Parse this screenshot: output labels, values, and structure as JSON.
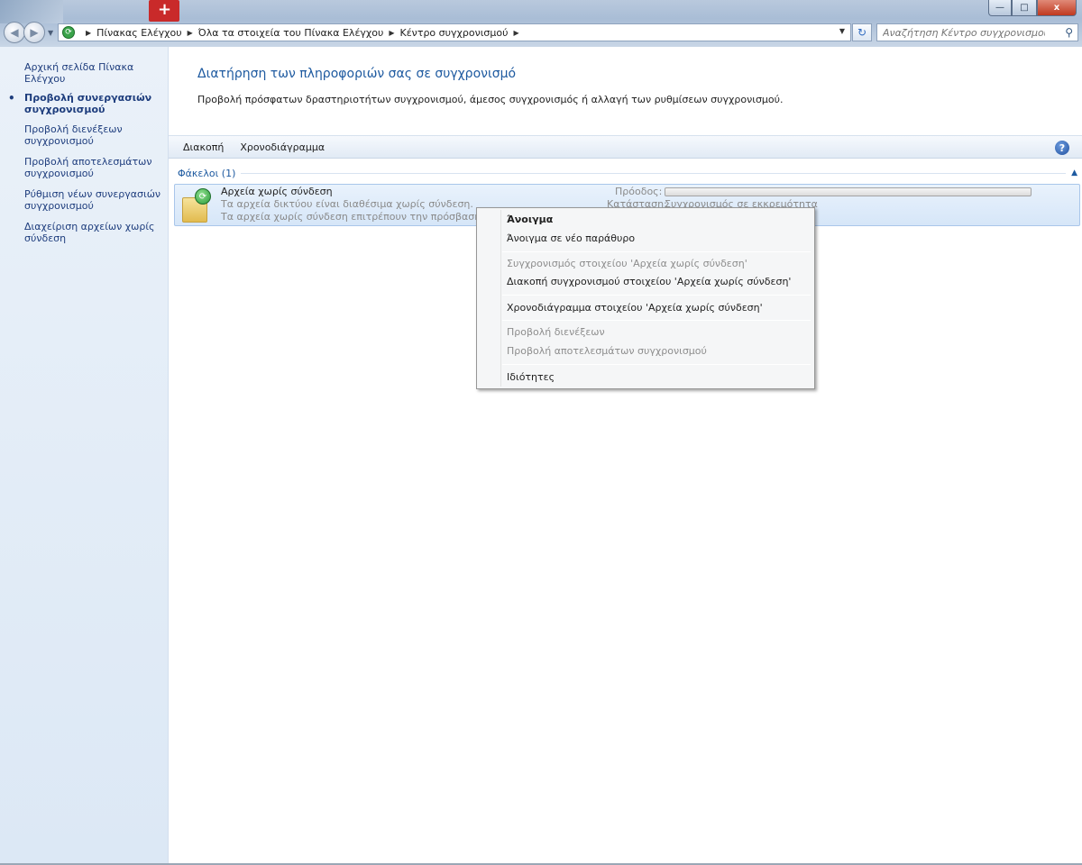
{
  "window": {
    "min_icon": "minimize-icon",
    "max_icon": "maximize-icon",
    "close_icon": "close-icon",
    "close_glyph": "x"
  },
  "address": {
    "segments": [
      "Πίνακας Ελέγχου",
      "Όλα τα στοιχεία του Πίνακα Ελέγχου",
      "Κέντρο συγχρονισμού"
    ]
  },
  "search": {
    "placeholder": "Αναζήτηση Κέντρο συγχρονισμού"
  },
  "sidebar": {
    "items": [
      {
        "label": "Αρχική σελίδα Πίνακα Ελέγχου",
        "active": false
      },
      {
        "label": "Προβολή συνεργασιών συγχρονισμού",
        "active": true
      },
      {
        "label": "Προβολή διενέξεων συγχρονισμού",
        "active": false
      },
      {
        "label": "Προβολή αποτελεσμάτων συγχρονισμού",
        "active": false
      },
      {
        "label": "Ρύθμιση νέων συνεργασιών συγχρονισμού",
        "active": false
      },
      {
        "label": "Διαχείριση αρχείων χωρίς σύνδεση",
        "active": false
      }
    ]
  },
  "main": {
    "title": "Διατήρηση των πληροφοριών σας σε συγχρονισμό",
    "subtitle": "Προβολή πρόσφατων δραστηριοτήτων συγχρονισμού, άμεσος συγχρονισμός ή αλλαγή των ρυθμίσεων συγχρονισμού."
  },
  "toolbar": {
    "stop_label": "Διακοπή",
    "schedule_label": "Χρονοδιάγραμμα",
    "help_glyph": "?"
  },
  "group": {
    "label": "Φάκελοι (1)"
  },
  "item": {
    "title": "Αρχεία χωρίς σύνδεση",
    "desc1": "Τα αρχεία δικτύου είναι διαθέσιμα χωρίς σύνδεση.",
    "desc2": "Τα αρχεία χωρίς σύνδεση επιτρέπουν την πρόσβαση αρ",
    "progress_label": "Πρόοδος:",
    "progress": 0,
    "status_label": "Κατάσταση:",
    "status_value": "Συγχρονισμός σε εκκρεμότητα"
  },
  "context_menu": {
    "items": [
      {
        "label": "Άνοιγμα",
        "bold": true,
        "disabled": false
      },
      {
        "label": "Άνοιγμα σε νέο παράθυρο",
        "bold": false,
        "disabled": false
      },
      {
        "label": "Συγχρονισμός στοιχείου 'Αρχεία χωρίς σύνδεση'",
        "bold": false,
        "disabled": true
      },
      {
        "label": "Διακοπή συγχρονισμού στοιχείου 'Αρχεία χωρίς σύνδεση'",
        "bold": false,
        "disabled": false
      },
      {
        "label": "Χρονοδιάγραμμα στοιχείου 'Αρχεία χωρίς σύνδεση'",
        "bold": false,
        "disabled": false
      },
      {
        "label": "Προβολή διενέξεων",
        "bold": false,
        "disabled": true
      },
      {
        "label": "Προβολή αποτελεσμάτων συγχρονισμού",
        "bold": false,
        "disabled": true
      },
      {
        "label": "Ιδιότητες",
        "bold": false,
        "disabled": false
      }
    ]
  },
  "colors": {
    "accent": "#1e5aa0",
    "sidebar_link": "#1e3d7d",
    "selection": "#d6e6f8"
  }
}
